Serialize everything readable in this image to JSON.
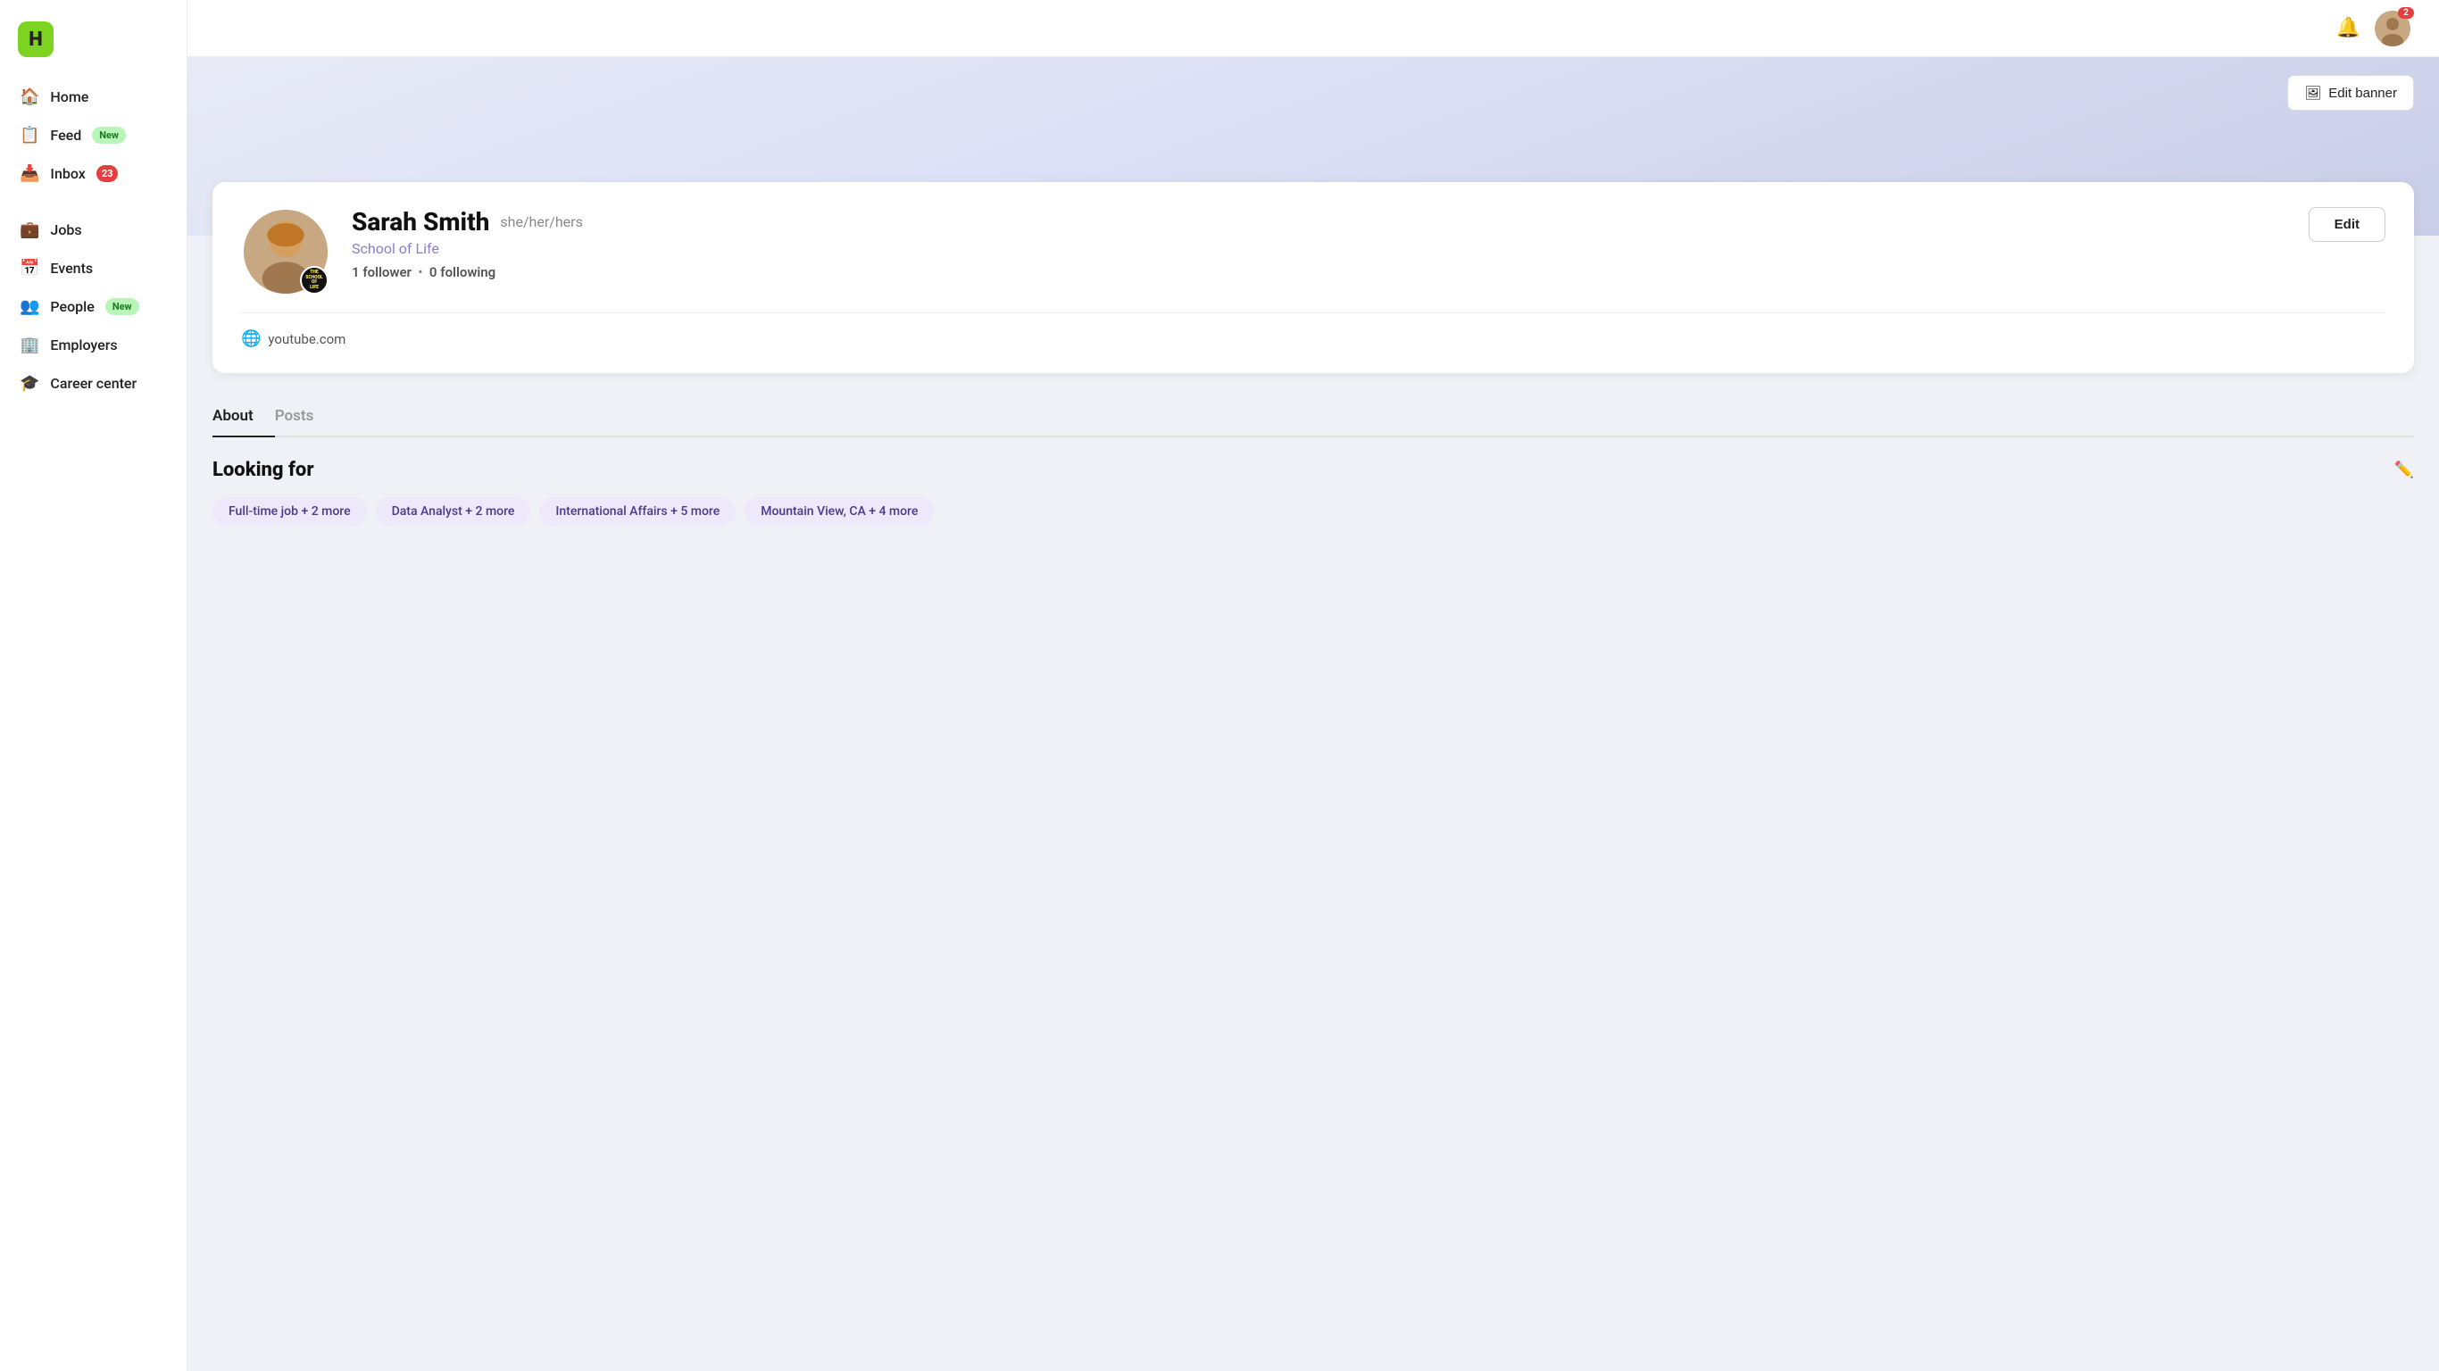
{
  "app": {
    "logo": "H"
  },
  "sidebar": {
    "items": [
      {
        "id": "home",
        "label": "Home",
        "icon": "🏠",
        "badge": null
      },
      {
        "id": "feed",
        "label": "Feed",
        "icon": "📋",
        "badge": {
          "text": "New",
          "type": "green"
        }
      },
      {
        "id": "inbox",
        "label": "Inbox",
        "icon": "📥",
        "badge": {
          "text": "23",
          "type": "red"
        }
      },
      {
        "id": "jobs",
        "label": "Jobs",
        "icon": "💼",
        "badge": null
      },
      {
        "id": "events",
        "label": "Events",
        "icon": "📅",
        "badge": null
      },
      {
        "id": "people",
        "label": "People",
        "icon": "👥",
        "badge": {
          "text": "New",
          "type": "green"
        }
      },
      {
        "id": "employers",
        "label": "Employers",
        "icon": "🏢",
        "badge": null
      },
      {
        "id": "career-center",
        "label": "Career center",
        "icon": "🎓",
        "badge": null
      }
    ]
  },
  "topbar": {
    "notification_count": "2"
  },
  "banner": {
    "edit_label": "Edit banner"
  },
  "profile": {
    "name": "Sarah Smith",
    "pronouns": "she/her/hers",
    "school": "School of Life",
    "followers": "1",
    "following": "0",
    "followers_label": "follower",
    "following_label": "following",
    "website": "youtube.com",
    "edit_label": "Edit",
    "school_badge": "THE SCHOOL OF LIFE"
  },
  "tabs": [
    {
      "id": "about",
      "label": "About",
      "active": true
    },
    {
      "id": "posts",
      "label": "Posts",
      "active": false
    }
  ],
  "about": {
    "looking_for_title": "Looking for",
    "tags": [
      "Full-time job + 2 more",
      "Data Analyst + 2 more",
      "International Affairs + 5 more",
      "Mountain View, CA + 4 more"
    ]
  }
}
